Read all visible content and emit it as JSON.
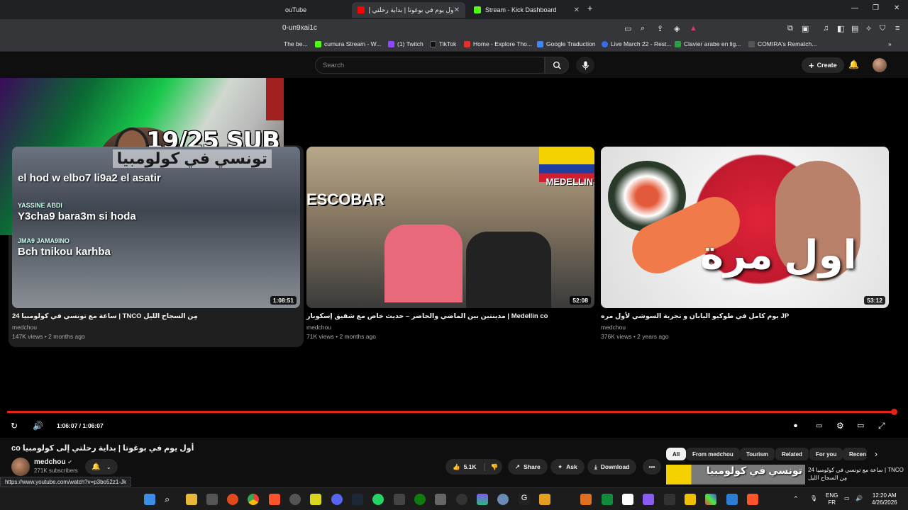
{
  "browser": {
    "tabs": [
      {
        "label": "ouTube",
        "active": false
      },
      {
        "label": "أول يوم في بوغوتا | بداية رحلتي إ...",
        "active": true
      },
      {
        "label": "Stream - Kick Dashboard",
        "active": false
      }
    ],
    "new_tab": "+",
    "url": "0-un9xai1c",
    "bookmarks": [
      {
        "label": "The be...",
        "color": "#444444"
      },
      {
        "label": "cumura Stream - W...",
        "color": "#53fc18"
      },
      {
        "label": "(1) Twitch",
        "color": "#9146ff"
      },
      {
        "label": "TikTok",
        "color": "#111111"
      },
      {
        "label": "Home - Explore Tho...",
        "color": "#e03030"
      },
      {
        "label": "Google Traduction",
        "color": "#4285f4"
      },
      {
        "label": "Live March 22 - Rest...",
        "color": "#3a6ee8"
      },
      {
        "label": "Clavier arabe en lig...",
        "color": "#2ea043"
      },
      {
        "label": "COMIRA's Rematch...",
        "color": "#555555"
      }
    ]
  },
  "youtube": {
    "search_placeholder": "Search",
    "create_label": "Create"
  },
  "overlay": {
    "sub_counter": "19/25 SUB"
  },
  "videos": [
    {
      "title": "24 ساعة مع تونسي في كولومبيا | TNCO مِن السجاح الليل",
      "channel": "medchou",
      "meta": "147K views • 2 months ago",
      "duration": "1:08:51",
      "thumb_lines": [
        "el hod w elbo7 li9a2 el asatir",
        "Y3cha9 bara3m si hoda",
        "Bch tnikou karhba"
      ],
      "thumb_arabic": "تونسي في كولومبيا",
      "thumb_tags": [
        "YASSINE ABDI",
        "JMA9 JAMA9INO"
      ]
    },
    {
      "title": "مدينتين بين الماضي والحاضر – حديث خاص مع شقيق إسكوبار | Medellin co",
      "channel": "medchou",
      "meta": "71K views • 2 months ago",
      "duration": "52:08",
      "thumb_left": "ESCOBAR",
      "thumb_right": "MEDELLIN"
    },
    {
      "title": "يوم كامل في طوكيو اليابان و تجربة السوشي لأول مره JP",
      "channel": "medchou",
      "meta": "376K views • 2 years ago",
      "duration": "53:12",
      "thumb_arabic": "اول مرة"
    }
  ],
  "player": {
    "time": "1:06:07 / 1:06:07",
    "progress": 1.0
  },
  "watch": {
    "title": "co أول يوم في بوغوتا | بداية رحلتي إلى كولومبيا",
    "channel": "medchou",
    "subscribers": "271K subscribers",
    "likes": "5.1K",
    "share": "Share",
    "ask": "Ask",
    "download": "Download",
    "more": "•••"
  },
  "chips": [
    "All",
    "From medchou",
    "Tourism",
    "Related",
    "For you",
    "Recen"
  ],
  "recommended": {
    "title": "24 ساعة مع تونسي في كولومبيا | TNCO مِن السجاح الليل",
    "thumb_text": "تونسي في كولومبيا"
  },
  "status_url": "https://www.youtube.com/watch?v=p3bo52z1-Jk",
  "taskbar": {
    "lang_top": "ENG",
    "lang_bottom": "FR",
    "time": "12:20 AM",
    "date": "4/26/2026"
  }
}
